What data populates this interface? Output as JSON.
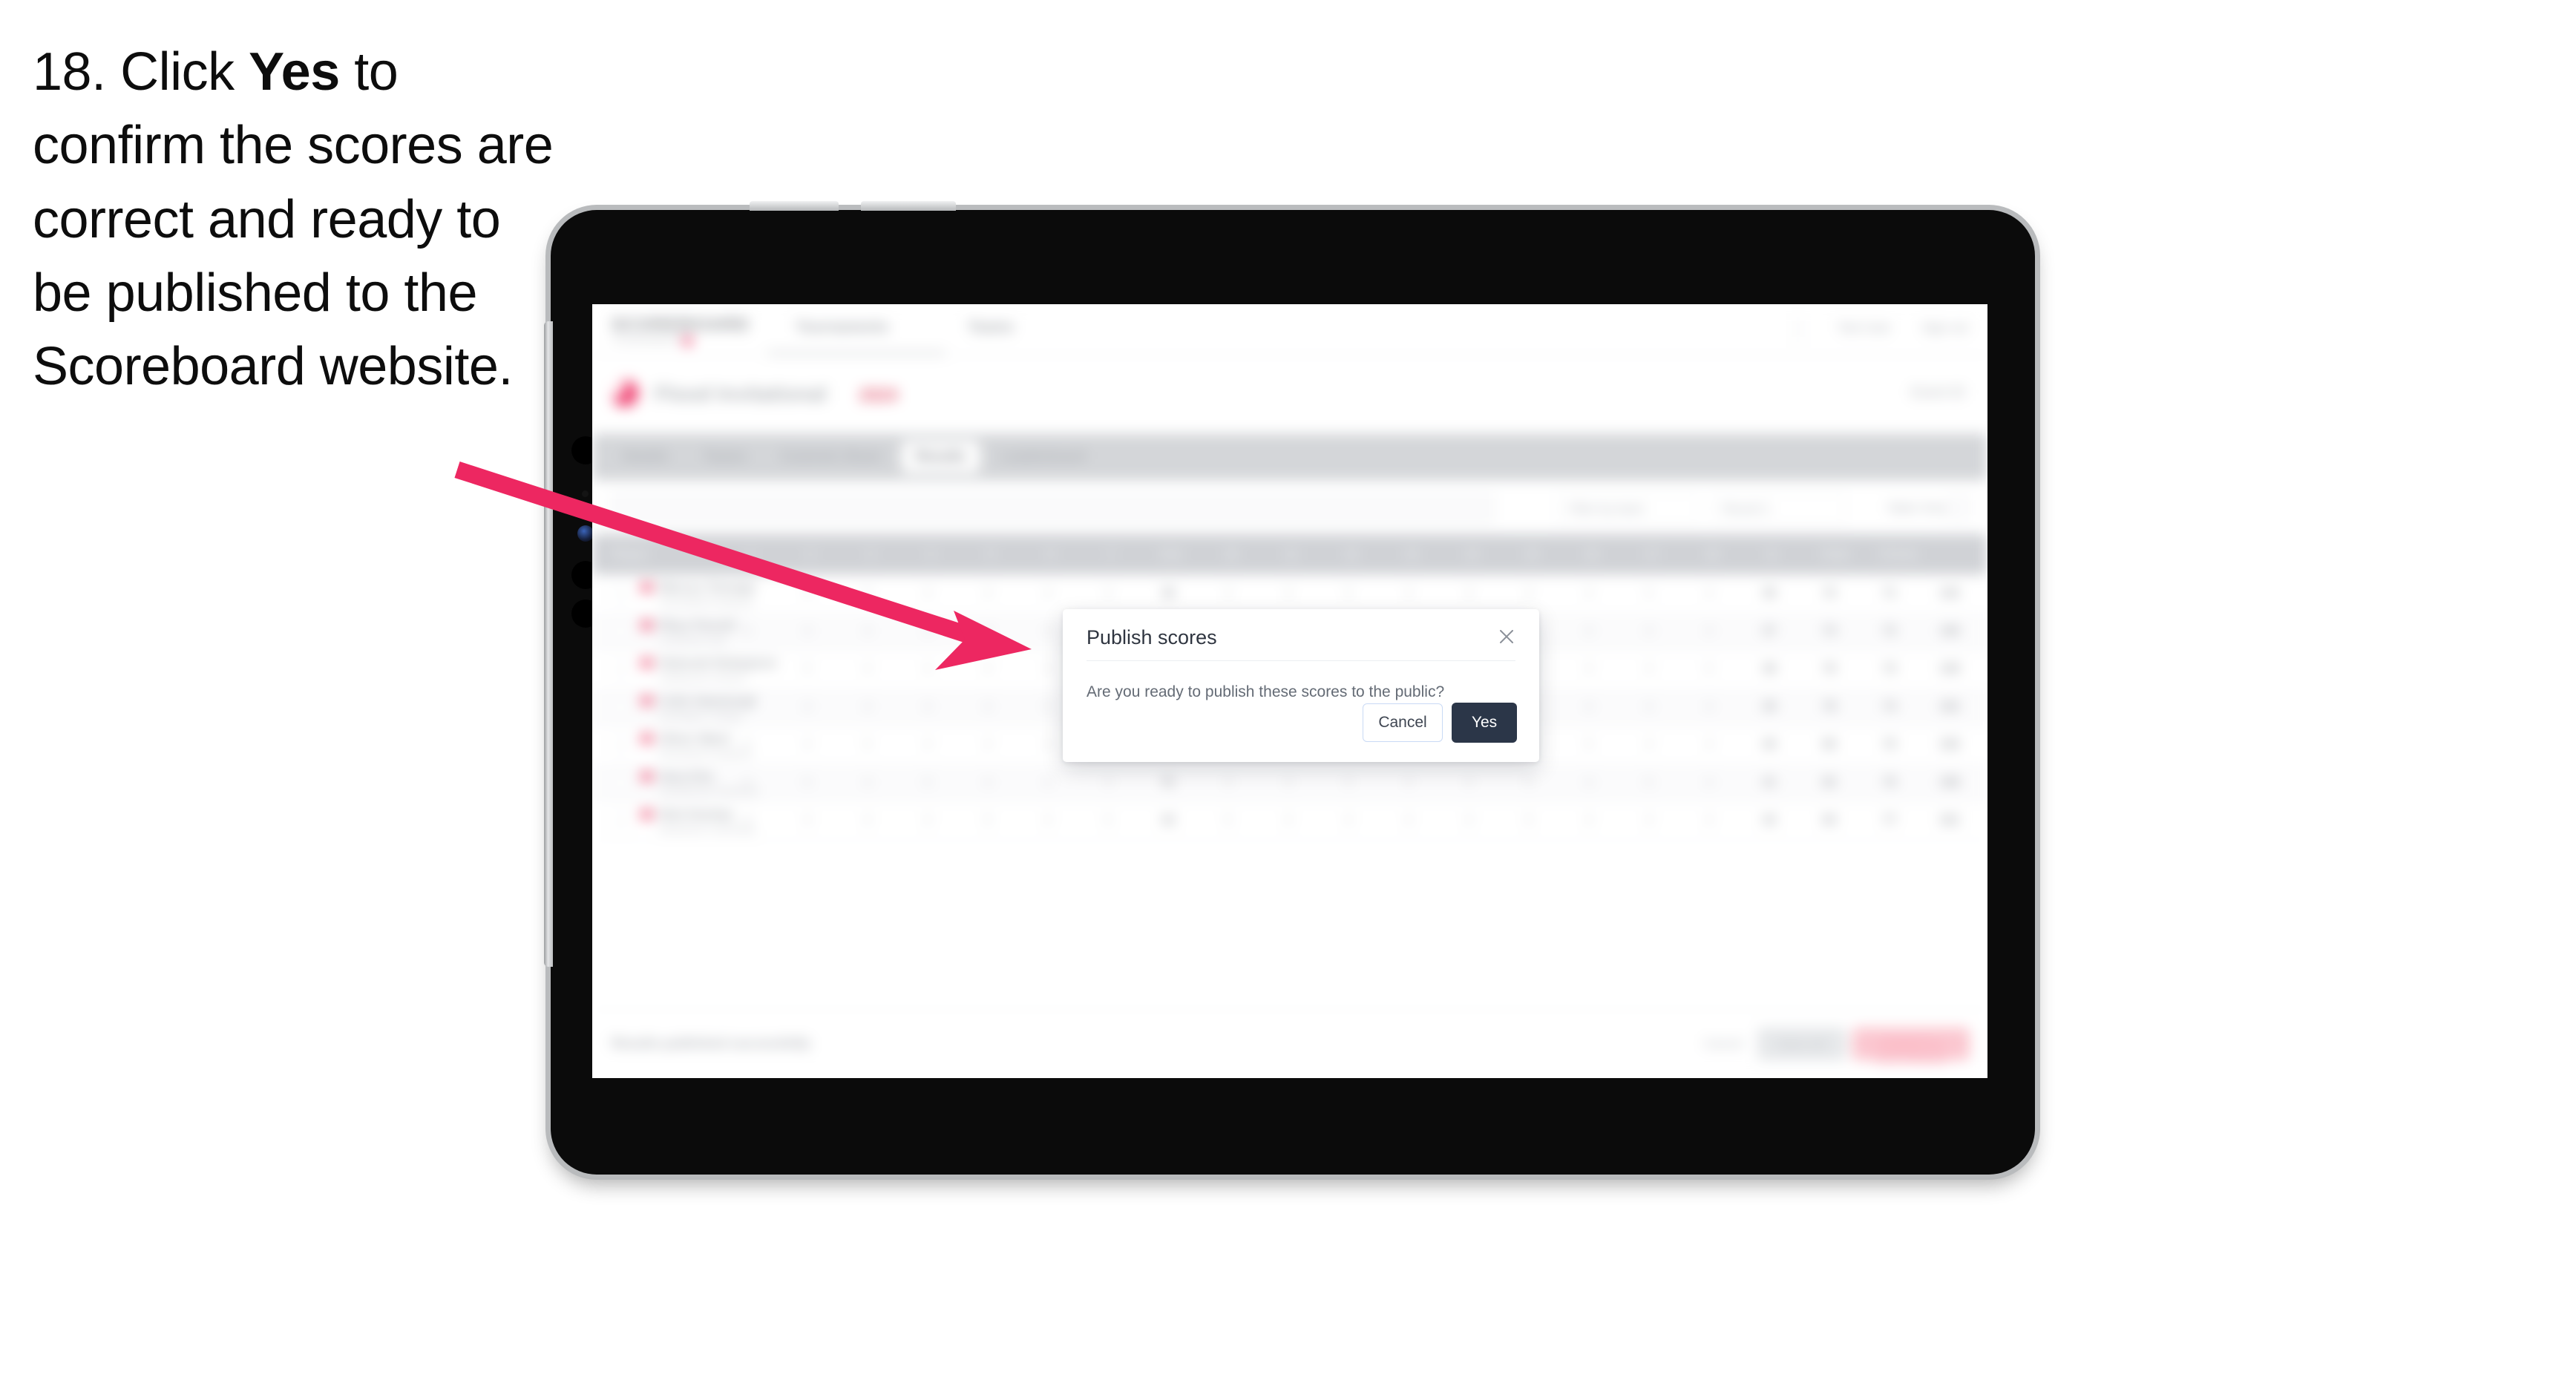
{
  "instruction": {
    "number": "18.",
    "pre": "Click",
    "emphasis": "Yes",
    "post": "to confirm the scores are correct and ready to be published to the Scoreboard website."
  },
  "colors": {
    "arrow": "#ed2761",
    "accent_pink": "#ef3c6d",
    "primary_dark": "#2b3648",
    "cancel_border": "#c9daf5",
    "device_body": "#0b0b0b",
    "device_rail": "#b9bbbd"
  },
  "device": {
    "type": "tablet",
    "orientation": "landscape"
  },
  "app": {
    "topbar": {
      "logo": "SCOREBOARD",
      "logo_sub": "TOURNAMENTS",
      "nav": [
        "Tournaments",
        "Teams"
      ],
      "account": "Test User",
      "signout": "Sign out"
    },
    "event_header": {
      "title": "Flood Invitational",
      "subtitle": "2024",
      "right_label": "Event ID"
    },
    "tabs": [
      {
        "label": "Details",
        "active": false
      },
      {
        "label": "Teams",
        "active": false
      },
      {
        "label": "Controls Sheet",
        "active": false
      },
      {
        "label": "Results",
        "active": true
      },
      {
        "label": "Leaderboard",
        "active": false
      }
    ],
    "filters": {
      "search_placeholder": "Search",
      "select_one": "Filter by team",
      "select_two": "Round 1",
      "plain_label": "Table Only",
      "icon": "settings-icon"
    },
    "table": {
      "columns": [
        "Player",
        "1",
        "2",
        "3",
        "4",
        "5",
        "6",
        "7",
        "Out",
        "10",
        "11",
        "12",
        "13",
        "14",
        "15",
        "16",
        "17",
        "18",
        "In",
        "Total",
        "Points"
      ],
      "rows": [
        {
          "name": "Marcus Tennant",
          "team": "Greenfield Academy",
          "scores": [
            "4",
            "4",
            "5",
            "3",
            "4",
            "4",
            "4",
            "36",
            "4",
            "4",
            "5",
            "4",
            "3",
            "4",
            "4",
            "5",
            "4",
            "36",
            "72",
            "71",
            "142",
            "132"
          ]
        },
        {
          "name": "Rhys Parnell",
          "team": "Crestview Hall",
          "scores": [
            "5",
            "4",
            "4",
            "3",
            "5",
            "4",
            "4",
            "37",
            "4",
            "4",
            "4",
            "4",
            "4",
            "5",
            "4",
            "4",
            "4",
            "37",
            "74",
            "72",
            "146",
            "128"
          ]
        },
        {
          "name": "Deborah Robertson",
          "team": "Ashbourne School",
          "scores": [
            "4",
            "5",
            "4",
            "4",
            "4",
            "4",
            "5",
            "38",
            "5",
            "4",
            "4",
            "4",
            "4",
            "4",
            "4",
            "4",
            "5",
            "38",
            "76",
            "73",
            "149",
            "124"
          ]
        },
        {
          "name": "Colin Hammond",
          "team": "Northgate College",
          "scores": [
            "4",
            "4",
            "4",
            "4",
            "4",
            "5",
            "4",
            "39",
            "4",
            "5",
            "4",
            "4",
            "5",
            "4",
            "4",
            "4",
            "4",
            "39",
            "78",
            "74",
            "152",
            "120"
          ]
        },
        {
          "name": "Oliver Ward",
          "team": "Riverbank Academy",
          "scores": [
            "5",
            "4",
            "5",
            "4",
            "4",
            "4",
            "4",
            "40",
            "4",
            "4",
            "4",
            "5",
            "4",
            "4",
            "5",
            "4",
            "4",
            "40",
            "80",
            "75",
            "155",
            "116"
          ]
        },
        {
          "name": "Sara Kim",
          "team": "Southbrook Grammar",
          "scores": [
            "4",
            "5",
            "4",
            "5",
            "4",
            "4",
            "4",
            "41",
            "4",
            "4",
            "5",
            "4",
            "4",
            "4",
            "4",
            "5",
            "4",
            "41",
            "82",
            "76",
            "158",
            "112"
          ]
        },
        {
          "name": "Nick Dunlop",
          "team": "Westmere University",
          "scores": [
            "4",
            "4",
            "4",
            "4",
            "5",
            "4",
            "5",
            "42",
            "5",
            "4",
            "4",
            "4",
            "4",
            "5",
            "4",
            "4",
            "4",
            "42",
            "84",
            "77",
            "161",
            "108"
          ]
        }
      ]
    },
    "footer": {
      "note": "Results published successfully",
      "link": "Cancel",
      "secondary_button": "Save all",
      "primary_button": "Publish to Scoreboard"
    }
  },
  "modal": {
    "title": "Publish scores",
    "close_icon": "close-icon",
    "body": "Are you ready to publish these scores to the public?",
    "cancel_label": "Cancel",
    "confirm_label": "Yes"
  }
}
